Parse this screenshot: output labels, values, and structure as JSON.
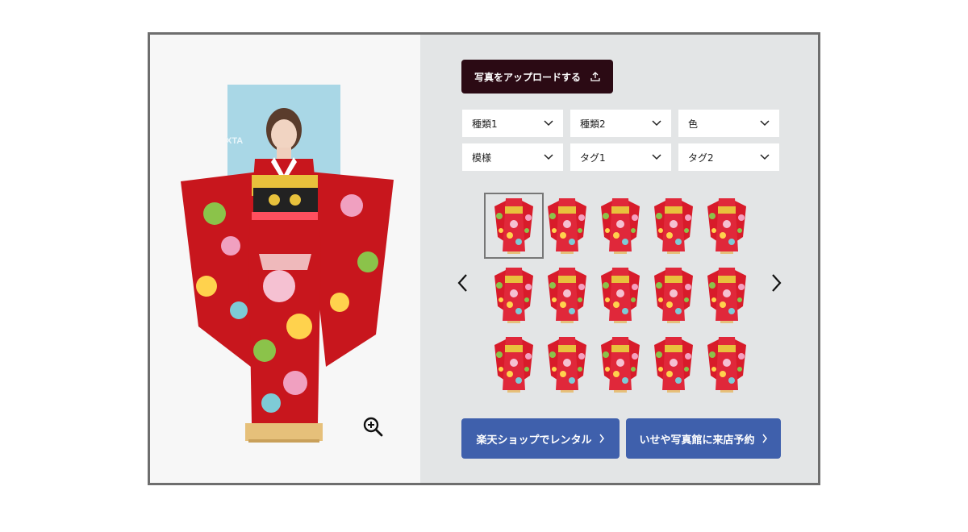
{
  "upload": {
    "label": "写真をアップロードする",
    "icon": "upload-icon"
  },
  "filters": [
    {
      "label": "種類1",
      "icon": "chevron-down-icon"
    },
    {
      "label": "種類2",
      "icon": "chevron-down-icon"
    },
    {
      "label": "色",
      "icon": "chevron-down-icon"
    },
    {
      "label": "模様",
      "icon": "chevron-down-icon"
    },
    {
      "label": "タグ1",
      "icon": "chevron-down-icon"
    },
    {
      "label": "タグ2",
      "icon": "chevron-down-icon"
    }
  ],
  "gallery": {
    "rows": 3,
    "cols": 5,
    "selected_index": 0,
    "prev_icon": "chevron-left-icon",
    "next_icon": "chevron-right-icon"
  },
  "preview": {
    "backdrop_text": "XTA",
    "zoom_icon": "zoom-in-icon"
  },
  "cta": {
    "rakuten_label": "楽天ショップでレンタル",
    "isseya_label": "いせや写真館に来店予約"
  },
  "colors": {
    "upload_bg": "#2b0a14",
    "cta_bg": "#3f60ac",
    "panel_bg": "#e3e5e6",
    "kimono_red": "#c8161d",
    "frame_border": "#6e6e6e"
  }
}
